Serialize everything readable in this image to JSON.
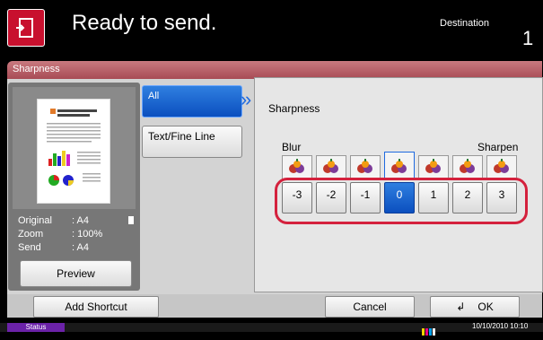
{
  "header": {
    "title": "Ready to send.",
    "destination_label": "Destination",
    "destination_count": "1",
    "icon": "send-document-icon"
  },
  "titlebar": {
    "title": "Sharpness"
  },
  "preview": {
    "original_label": "Original",
    "original_value": ": A4",
    "zoom_label": "Zoom",
    "zoom_value": ": 100%",
    "send_label": "Send",
    "send_value": ": A4",
    "preview_button": "Preview"
  },
  "tabs": [
    {
      "label": "All",
      "selected": true
    },
    {
      "label": "Text/Fine Line",
      "selected": false
    }
  ],
  "sharpness": {
    "title": "Sharpness",
    "blur_label": "Blur",
    "sharpen_label": "Sharpen",
    "levels": [
      "-3",
      "-2",
      "-1",
      "0",
      "1",
      "2",
      "3"
    ],
    "selected_level": "0"
  },
  "footer": {
    "add_shortcut": "Add Shortcut",
    "cancel": "Cancel",
    "ok": "OK"
  },
  "status": {
    "label": "Status",
    "datetime": "10/10/2010 10:10"
  },
  "colors": {
    "accent": "#c8102e",
    "selected_blue": "#0b4fbf",
    "highlight_ring": "#d4213d"
  }
}
